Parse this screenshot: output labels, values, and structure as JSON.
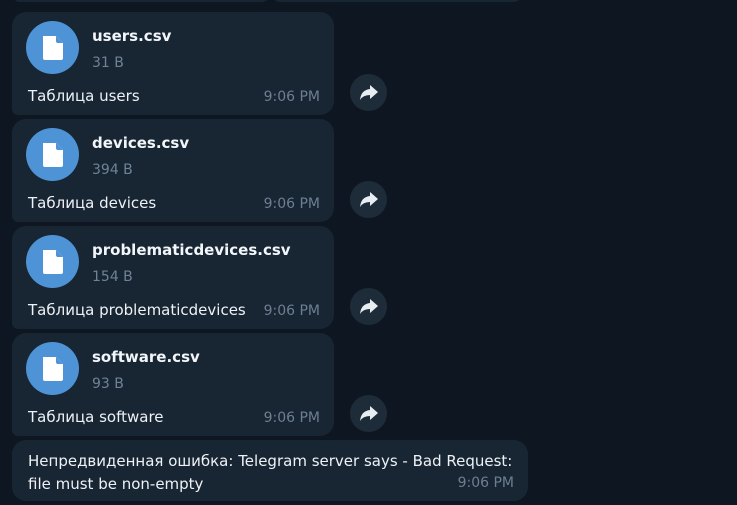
{
  "colors": {
    "background": "#0e1621",
    "bubble": "#182533",
    "file_icon_accent": "#4e93d6",
    "muted_text": "#6f8396"
  },
  "icons": {
    "file": "file-icon",
    "share": "share-arrow-icon"
  },
  "messages": [
    {
      "file_name": "users.csv",
      "file_size": "31 B",
      "caption": "Таблица users",
      "time": "9:06 PM"
    },
    {
      "file_name": "devices.csv",
      "file_size": "394 B",
      "caption": "Таблица devices",
      "time": "9:06 PM"
    },
    {
      "file_name": "problematicdevices.csv",
      "file_size": "154 B",
      "caption": "Таблица problematicdevices",
      "time": "9:06 PM"
    },
    {
      "file_name": "software.csv",
      "file_size": "93 B",
      "caption": "Таблица software",
      "time": "9:06 PM"
    }
  ],
  "error_message": {
    "text": "Непредвиденная ошибка: Telegram server says - Bad Request: file must be non-empty",
    "time": "9:06 PM"
  }
}
